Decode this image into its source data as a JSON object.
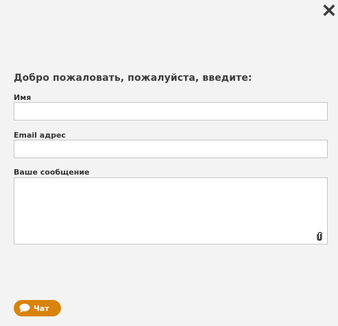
{
  "header": {
    "close_icon": "close-icon"
  },
  "form": {
    "welcome_text": "Добро пожаловать, пожалуйста, введите:",
    "name_label": "Имя",
    "name_value": "",
    "email_label": "Email адрес",
    "email_value": "",
    "message_label": "Ваше сообщение",
    "message_value": "",
    "attach_icon": "paperclip-icon"
  },
  "footer": {
    "chat_label": "Чат",
    "chat_icon": "speech-bubble-icon",
    "chat_color": "#d9830c"
  },
  "colors": {
    "background": "#f3f3f3",
    "input_border": "#c4c4c4",
    "text": "#333333"
  }
}
